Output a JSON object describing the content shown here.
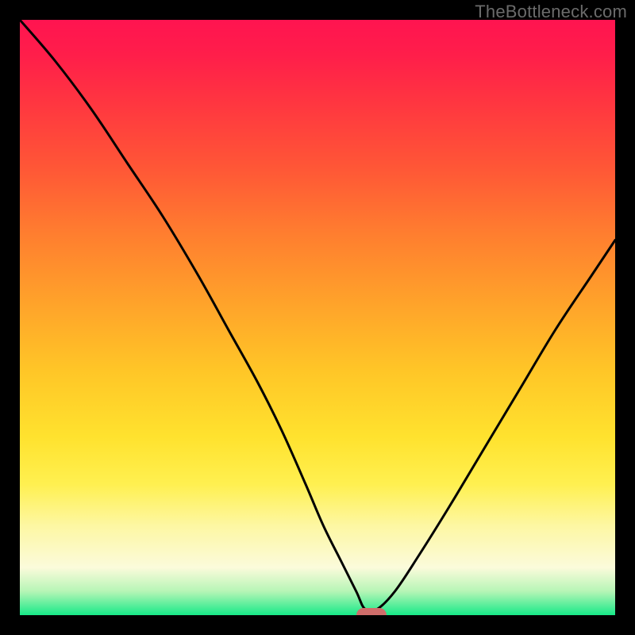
{
  "watermark": "TheBottleneck.com",
  "colors": {
    "black": "#000000",
    "curve": "#000000",
    "marker": "#cf6d6a"
  },
  "chart_data": {
    "type": "line",
    "title": "",
    "xlabel": "",
    "ylabel": "",
    "xlim": [
      0,
      100
    ],
    "ylim": [
      0,
      100
    ],
    "grid": false,
    "legend": false,
    "marker": {
      "x": 59,
      "y": 0
    },
    "series": [
      {
        "name": "bottleneck-curve",
        "x": [
          0,
          6,
          12,
          18,
          24,
          30,
          35,
          40,
          44,
          48,
          51,
          54,
          56.5,
          58,
          60,
          63,
          67,
          72,
          78,
          84,
          90,
          96,
          100
        ],
        "values": [
          100,
          93,
          85,
          76,
          67,
          57,
          48,
          39,
          31,
          22,
          15,
          9,
          4,
          1,
          1,
          4,
          10,
          18,
          28,
          38,
          48,
          57,
          63
        ]
      }
    ]
  }
}
